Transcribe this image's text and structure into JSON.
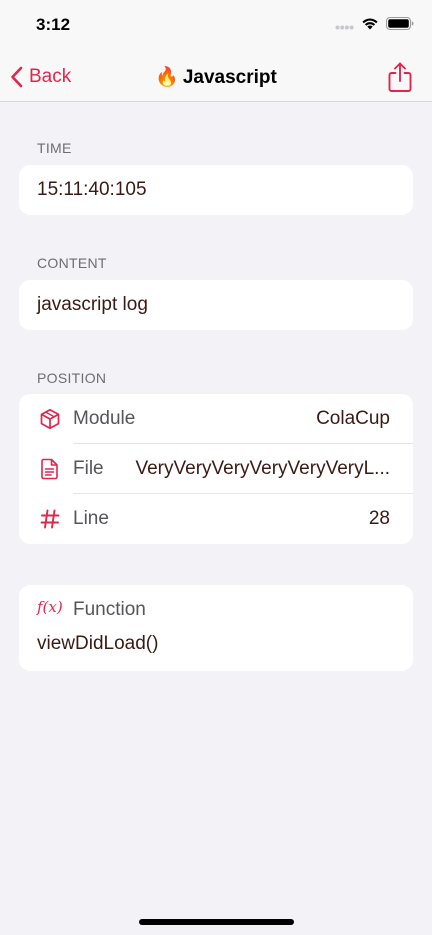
{
  "status": {
    "time": "3:12"
  },
  "nav": {
    "back_label": "Back",
    "emoji": "🔥",
    "title": "Javascript"
  },
  "sections": {
    "time": {
      "header": "TIME",
      "value": "15:11:40:105"
    },
    "content": {
      "header": "CONTENT",
      "value": "javascript log"
    },
    "position": {
      "header": "POSITION",
      "rows": [
        {
          "icon": "cube-icon",
          "label": "Module",
          "value": "ColaCup"
        },
        {
          "icon": "document-icon",
          "label": "File",
          "value": "VeryVeryVeryVeryVeryVeryL..."
        },
        {
          "icon": "number-icon",
          "label": "Line",
          "value": "28"
        }
      ]
    },
    "function": {
      "icon": "function-icon",
      "icon_glyph": "f(x)",
      "label": "Function",
      "value": "viewDidLoad()"
    }
  },
  "colors": {
    "accent": "#e0264b",
    "background": "#f2f2f7",
    "card": "#ffffff"
  }
}
